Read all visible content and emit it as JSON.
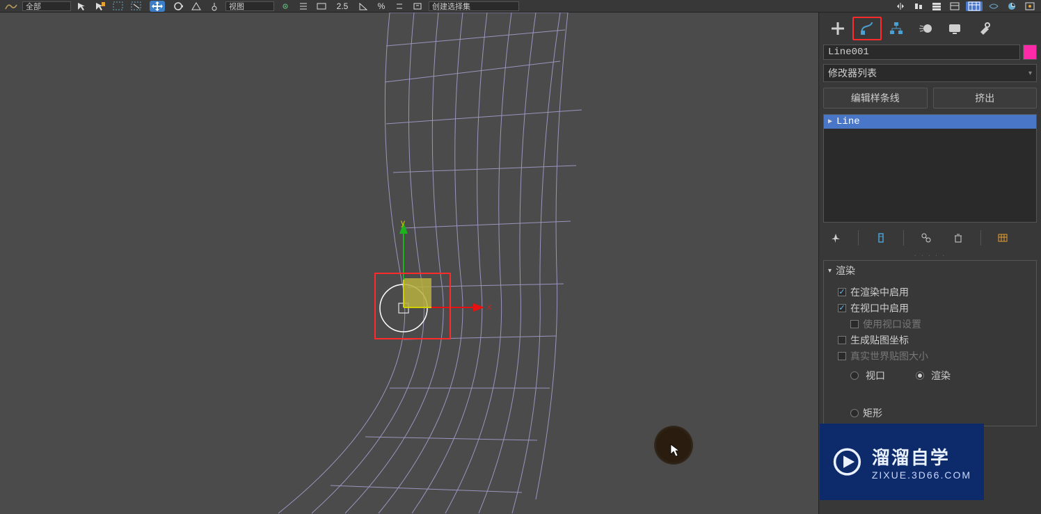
{
  "toolbar": {
    "filter_all": "全部",
    "view_dd": "视图",
    "snap_label": "2.5",
    "angle_label": "%",
    "sel_set_dd": "创建选择集"
  },
  "cmd_panel": {
    "tabs": [
      "create",
      "modify",
      "hierarchy",
      "motion",
      "display",
      "utilities"
    ],
    "object_name": "Line001",
    "modifier_list_label": "修改器列表",
    "mod_btns": {
      "edit_spline": "编辑样条线",
      "extrude": "挤出"
    },
    "stack": {
      "item0": "Line"
    },
    "rollout_render": {
      "title": "渲染",
      "enable_render": "在渲染中启用",
      "enable_viewport": "在视口中启用",
      "use_vp_settings": "使用视口设置",
      "gen_map": "生成贴图坐标",
      "realworld": "真实世界贴图大小",
      "radio_viewport": "视口",
      "radio_render": "渲染",
      "rect": "矩形"
    }
  },
  "axes": {
    "x": "x",
    "y": "y"
  },
  "watermark": {
    "main": "溜溜自学",
    "sub": "ZIXUE.3D66.COM"
  }
}
